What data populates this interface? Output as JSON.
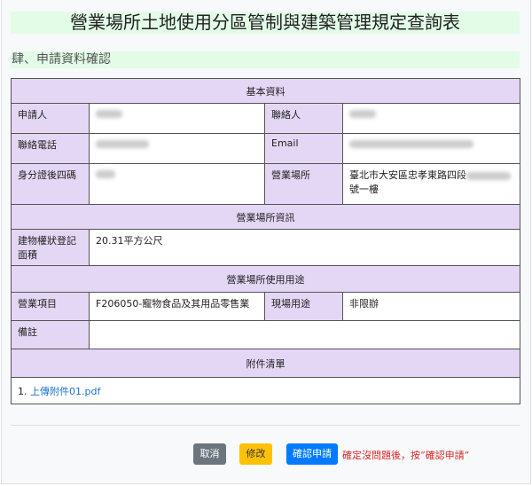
{
  "title": "營業場所土地使用分區管制與建築管理規定查詢表",
  "section": "肆、申請資料確認",
  "table": {
    "basic_header": "基本資料",
    "applicant_label": "申請人",
    "contact_label": "聯絡人",
    "phone_label": "聯絡電話",
    "email_label": "Email",
    "id_label": "身分證後四碼",
    "location_label": "營業場所",
    "location_value_prefix": "臺北市大安區忠孝東路四段",
    "location_value_suffix": "號一樓",
    "site_header": "營業場所資訊",
    "area_label": "建物權狀登記面積",
    "area_value": "20.31平方公尺",
    "usage_header": "營業場所使用用途",
    "business_label": "營業項目",
    "business_value": "F206050-寵物食品及其用品零售業",
    "current_use_label": "現場用途",
    "current_use_value": "非限辦",
    "remark_label": "備註",
    "attach_header": "附件清單",
    "attachment_index": "1.",
    "attachment_link": "上傳附件01.pdf"
  },
  "buttons": {
    "cancel": "取消",
    "edit": "修改",
    "confirm": "確認申請"
  },
  "buttons_colors": {
    "cancel": "#6c757d",
    "edit": "#ffc107",
    "confirm": "#007bff"
  },
  "note": "確定沒問題後，按“確認申請”"
}
